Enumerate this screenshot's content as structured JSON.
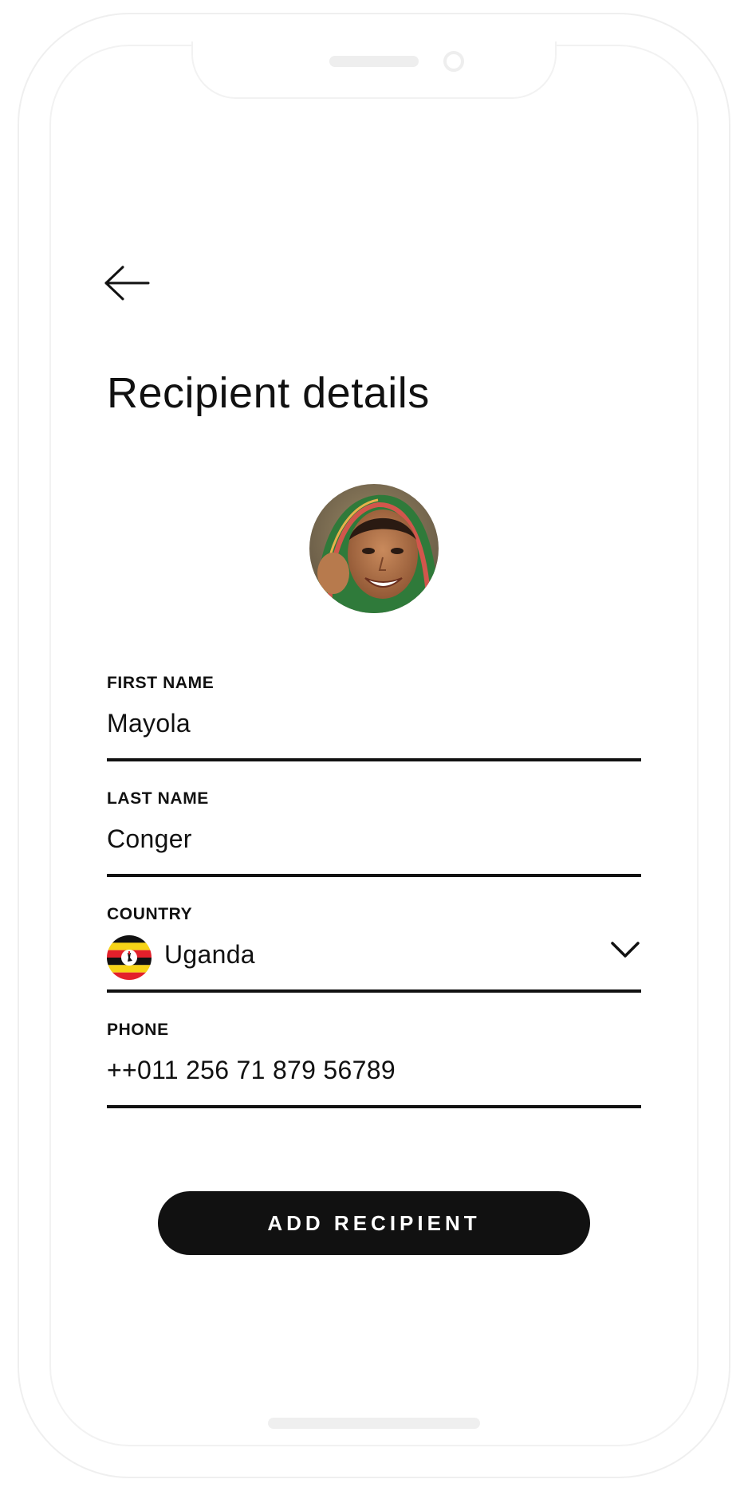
{
  "header": {
    "title": "Recipient details",
    "back_icon": "arrow-left-icon"
  },
  "recipient": {
    "avatar_icon": "avatar-photo"
  },
  "form": {
    "first_name": {
      "label": "FIRST NAME",
      "value": "Mayola"
    },
    "last_name": {
      "label": "LAST NAME",
      "value": "Conger"
    },
    "country": {
      "label": "COUNTRY",
      "value": "Uganda",
      "flag_icon": "uganda-flag-icon",
      "dropdown_icon": "chevron-down-icon"
    },
    "phone": {
      "label": "PHONE",
      "value": "++011 256 71 879 56789"
    }
  },
  "actions": {
    "add_recipient_label": "ADD RECIPIENT"
  },
  "colors": {
    "text": "#111111",
    "background": "#ffffff",
    "button": "#111111",
    "button_text": "#ffffff",
    "flag_black": "#111111",
    "flag_yellow": "#f7d417",
    "flag_red": "#e3202b"
  }
}
